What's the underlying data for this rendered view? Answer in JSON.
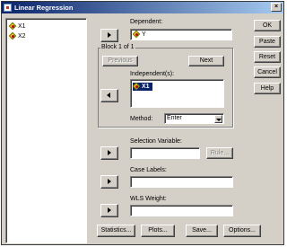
{
  "window": {
    "title": "Linear Regression",
    "close_glyph": "×"
  },
  "source_list": {
    "items": [
      {
        "label": "X1",
        "icon": "scale-variable-icon"
      },
      {
        "label": "X2",
        "icon": "scale-variable-icon"
      }
    ]
  },
  "dependent": {
    "label": "Dependent:",
    "value": "Y",
    "icon": "scale-variable-icon"
  },
  "block": {
    "title": "Block 1 of 1",
    "previous_label": "Previous",
    "next_label": "Next",
    "independents_label": "Independent(s):",
    "independents": [
      {
        "label": "X1",
        "icon": "scale-variable-icon",
        "selected": true
      }
    ],
    "method_label": "Method:",
    "method_value": "Enter"
  },
  "selection_variable": {
    "label": "Selection Variable:",
    "value": "",
    "rule_label": "Rule..."
  },
  "case_labels": {
    "label": "Case Labels:",
    "value": ""
  },
  "wls_weight": {
    "label": "WLS Weight:",
    "value": ""
  },
  "side_buttons": {
    "ok": "OK",
    "paste": "Paste",
    "reset": "Reset",
    "cancel": "Cancel",
    "help": "Help"
  },
  "bottom_buttons": {
    "statistics": "Statistics...",
    "plots": "Plots...",
    "save": "Save...",
    "options": "Options..."
  },
  "colors": {
    "title_start": "#0a246a",
    "title_end": "#a6caf0",
    "face": "#d4d0c8",
    "selection": "#0a246a"
  }
}
